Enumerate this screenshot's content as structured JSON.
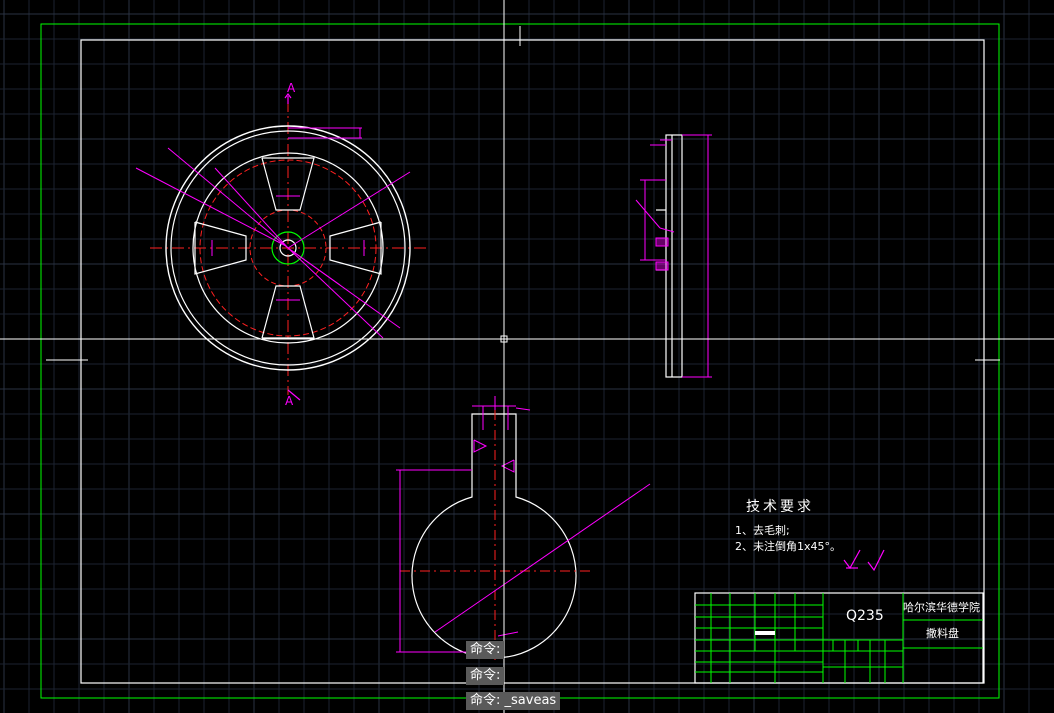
{
  "technical_requirements": {
    "title": "技术要求",
    "items": [
      "1、去毛刺;",
      "2、未注倒角1x45°。"
    ]
  },
  "title_block": {
    "material": "Q235",
    "school": "哈尔滨华德学院",
    "part_name": "撒料盘"
  },
  "section_marks": {
    "top": "A",
    "bottom": "A"
  },
  "command_lines": [
    "命令:",
    "命令:",
    "命令: _saveas"
  ],
  "colors": {
    "background": "#000000",
    "grid": "#1c2230",
    "grid_major": "#2a3242",
    "outline": "#ffffff",
    "dimension": "#ff00ff",
    "centerline": "#ff2020",
    "border": "#00ff00",
    "crosshair": "#ffffff"
  }
}
